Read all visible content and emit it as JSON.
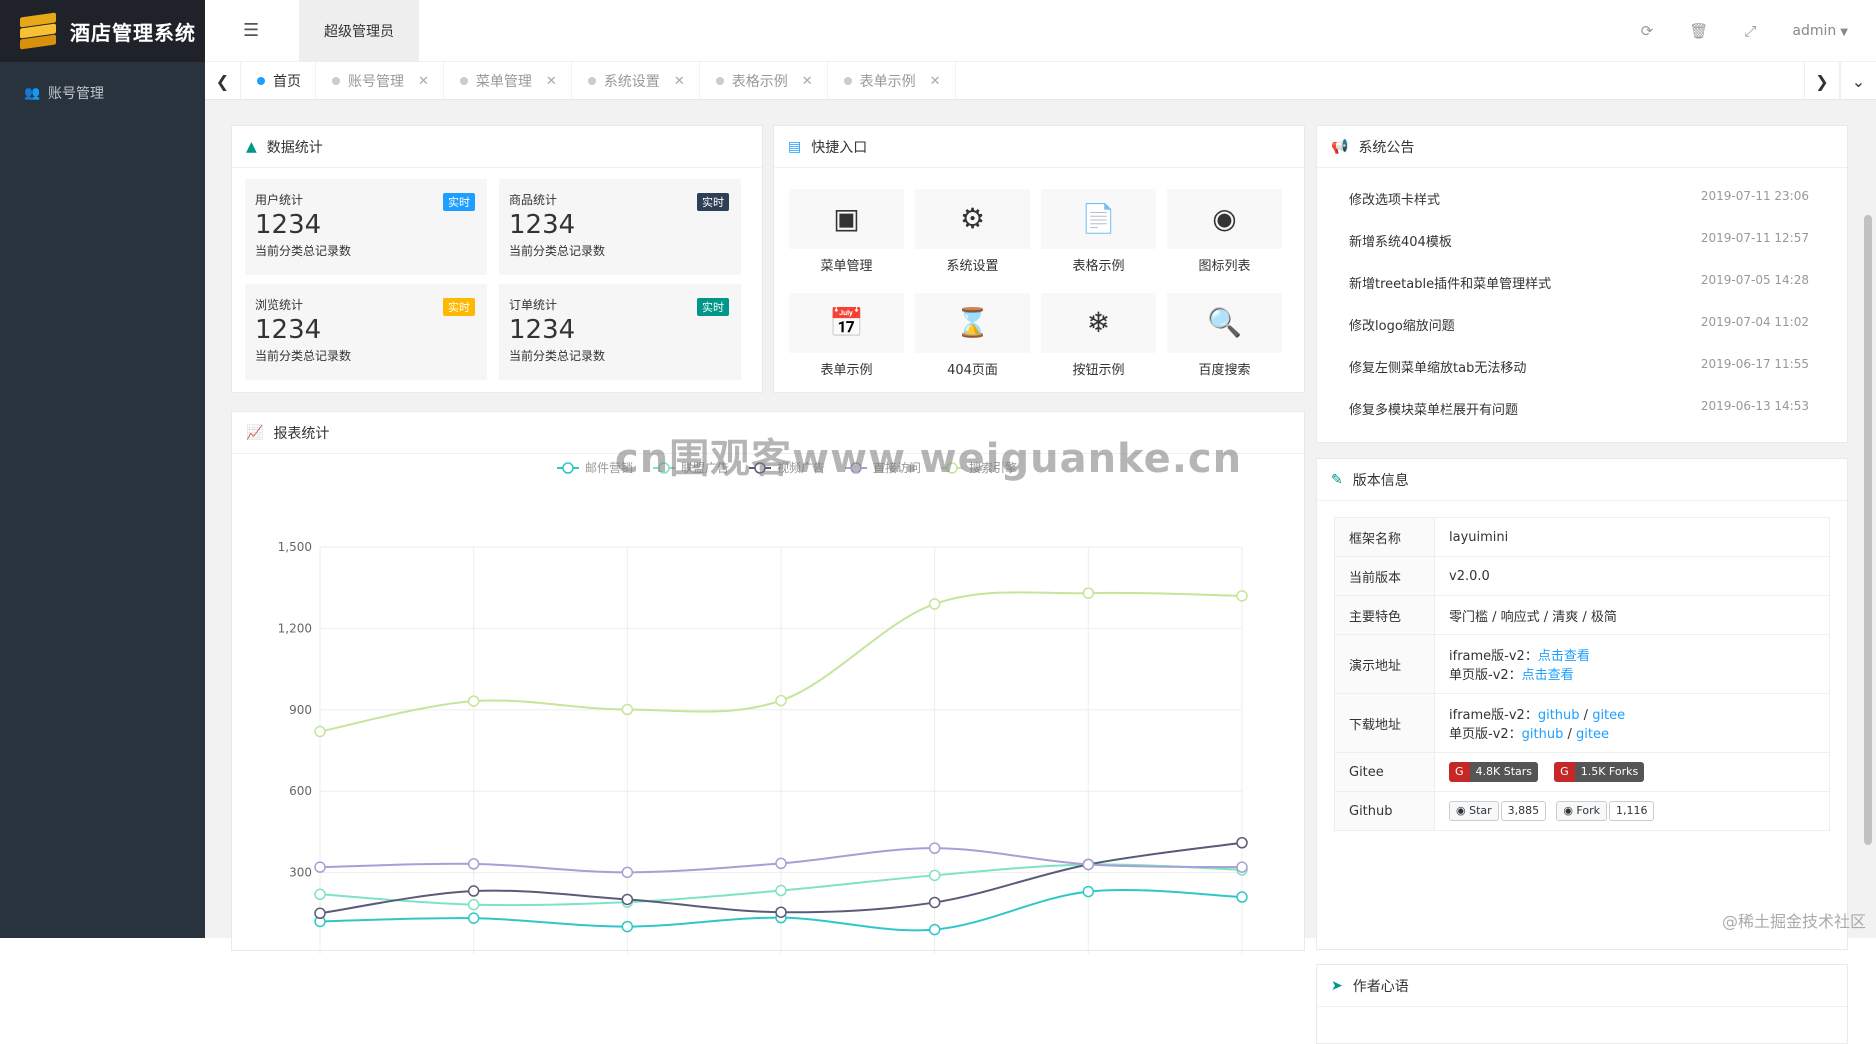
{
  "app": {
    "title": "酒店管理系统"
  },
  "sidebar": {
    "items": [
      {
        "label": "账号管理",
        "icon": "users-icon"
      }
    ]
  },
  "header": {
    "role": "超级管理员",
    "user": "admin"
  },
  "tabs": [
    {
      "label": "首页",
      "active": true
    },
    {
      "label": "账号管理"
    },
    {
      "label": "菜单管理"
    },
    {
      "label": "系统设置"
    },
    {
      "label": "表格示例"
    },
    {
      "label": "表单示例"
    }
  ],
  "stats": {
    "title": "数据统计",
    "items": [
      {
        "title": "用户统计",
        "badge": "实时",
        "badge_color": "#1e9fff",
        "value": "1234",
        "desc": "当前分类总记录数"
      },
      {
        "title": "商品统计",
        "badge": "实时",
        "badge_color": "#2f4056",
        "value": "1234",
        "desc": "当前分类总记录数"
      },
      {
        "title": "浏览统计",
        "badge": "实时",
        "badge_color": "#ffb800",
        "value": "1234",
        "desc": "当前分类总记录数"
      },
      {
        "title": "订单统计",
        "badge": "实时",
        "badge_color": "#009688",
        "value": "1234",
        "desc": "当前分类总记录数"
      }
    ]
  },
  "quick": {
    "title": "快捷入口",
    "items": [
      {
        "label": "菜单管理",
        "icon": "window-icon"
      },
      {
        "label": "系统设置",
        "icon": "gears-icon"
      },
      {
        "label": "表格示例",
        "icon": "file-icon"
      },
      {
        "label": "图标列表",
        "icon": "target-icon"
      },
      {
        "label": "表单示例",
        "icon": "calendar-icon"
      },
      {
        "label": "404页面",
        "icon": "hourglass-icon"
      },
      {
        "label": "按钮示例",
        "icon": "snowflake-icon"
      },
      {
        "label": "百度搜索",
        "icon": "search-icon"
      }
    ]
  },
  "notice": {
    "title": "系统公告",
    "items": [
      {
        "text": "修改选项卡样式",
        "date": "2019-07-11 23:06"
      },
      {
        "text": "新增系统404模板",
        "date": "2019-07-11 12:57"
      },
      {
        "text": "新增treetable插件和菜单管理样式",
        "date": "2019-07-05 14:28"
      },
      {
        "text": "修改logo缩放问题",
        "date": "2019-07-04 11:02"
      },
      {
        "text": "修复左侧菜单缩放tab无法移动",
        "date": "2019-06-17 11:55"
      },
      {
        "text": "修复多模块菜单栏展开有问题",
        "date": "2019-06-13 14:53"
      }
    ]
  },
  "version": {
    "title": "版本信息",
    "framework_k": "框架名称",
    "framework_v": "layuimini",
    "current_k": "当前版本",
    "current_v": "v2.0.0",
    "feature_k": "主要特色",
    "feature_v": "零门槛 / 响应式 / 清爽 / 极简",
    "demo_k": "演示地址",
    "demo_l1": "iframe版-v2：",
    "demo_a1": "点击查看",
    "demo_l2": "单页版-v2：",
    "demo_a2": "点击查看",
    "download_k": "下载地址",
    "dl_l1": "iframe版-v2：",
    "dl_l2": "单页版-v2：",
    "github": "github",
    "gitee": "gitee",
    "sep": " / ",
    "gitee_k": "Gitee",
    "gitee_stars": "4.8K Stars",
    "gitee_forks": "1.5K Forks",
    "github_k": "Github",
    "gh_star": "Star",
    "gh_star_count": "3,885",
    "gh_fork": "Fork",
    "gh_fork_count": "1,116"
  },
  "author": {
    "title": "作者心语"
  },
  "watermark": "cn围观客www.weiguanke.cn",
  "footer_mark": "@稀土掘金技术社区",
  "chart_data": {
    "type": "line",
    "title": "报表统计",
    "x": [
      "1",
      "2",
      "3",
      "4",
      "5",
      "6",
      "7"
    ],
    "ylim": [
      0,
      1500
    ],
    "yticks": [
      "300",
      "600",
      "900",
      "1,200",
      "1,500"
    ],
    "grid": true,
    "legend_position": "top-center",
    "series": [
      {
        "name": "邮件营销",
        "color": "#2ec7c9",
        "values": [
          120,
          132,
          101,
          134,
          90,
          230,
          210
        ]
      },
      {
        "name": "联盟广告",
        "color": "#7ee3c4",
        "values": [
          220,
          182,
          191,
          234,
          290,
          330,
          310
        ]
      },
      {
        "name": "视频广告",
        "color": "#5a5a7a",
        "values": [
          150,
          232,
          201,
          154,
          190,
          330,
          410
        ]
      },
      {
        "name": "直接访问",
        "color": "#a3a1d8",
        "values": [
          320,
          332,
          301,
          334,
          390,
          330,
          320
        ]
      },
      {
        "name": "搜索引擎",
        "color": "#c6e59b",
        "values": [
          820,
          932,
          901,
          934,
          1290,
          1330,
          1320
        ]
      }
    ]
  }
}
